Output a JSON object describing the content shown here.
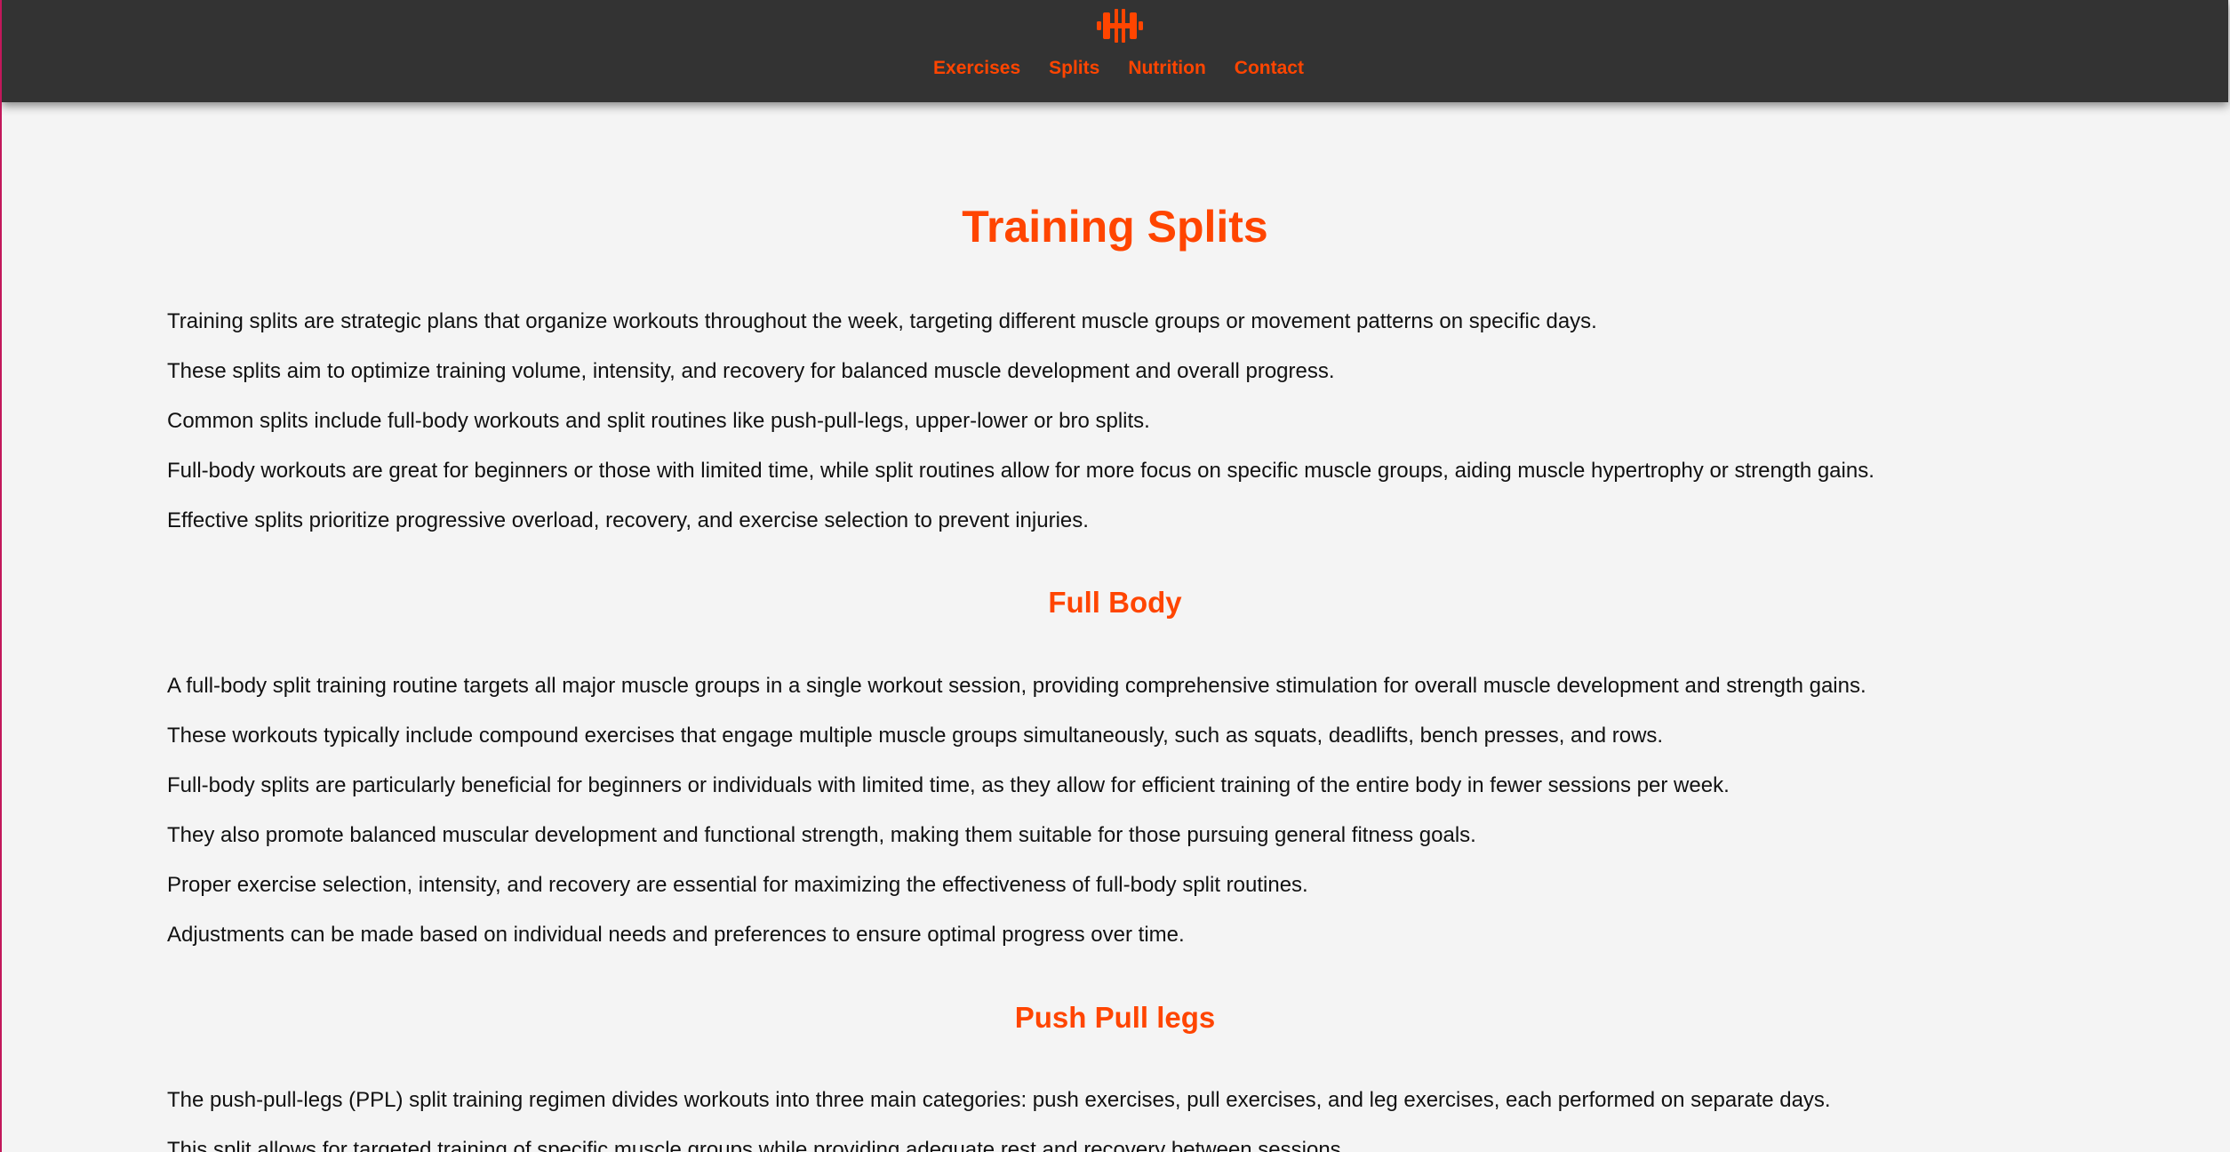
{
  "header": {
    "logo_icon": "dumbbell-icon",
    "accent_color": "#ff4500",
    "nav": [
      {
        "label": "Exercises"
      },
      {
        "label": "Splits"
      },
      {
        "label": "Nutrition"
      },
      {
        "label": "Contact"
      }
    ]
  },
  "main": {
    "title": "Training Splits",
    "intro": [
      "Training splits are strategic plans that organize workouts throughout the week, targeting different muscle groups or movement patterns on specific days.",
      "These splits aim to optimize training volume, intensity, and recovery for balanced muscle development and overall progress.",
      "Common splits include full-body workouts and split routines like push-pull-legs, upper-lower or bro splits.",
      "Full-body workouts are great for beginners or those with limited time, while split routines allow for more focus on specific muscle groups, aiding muscle hypertrophy or strength gains.",
      "Effective splits prioritize progressive overload, recovery, and exercise selection to prevent injuries."
    ],
    "sections": [
      {
        "title": "Full Body",
        "paragraphs": [
          "A full-body split training routine targets all major muscle groups in a single workout session, providing comprehensive stimulation for overall muscle development and strength gains.",
          "These workouts typically include compound exercises that engage multiple muscle groups simultaneously, such as squats, deadlifts, bench presses, and rows.",
          "Full-body splits are particularly beneficial for beginners or individuals with limited time, as they allow for efficient training of the entire body in fewer sessions per week.",
          "They also promote balanced muscular development and functional strength, making them suitable for those pursuing general fitness goals.",
          "Proper exercise selection, intensity, and recovery are essential for maximizing the effectiveness of full-body split routines.",
          "Adjustments can be made based on individual needs and preferences to ensure optimal progress over time."
        ]
      },
      {
        "title": "Push Pull legs",
        "paragraphs": [
          "The push-pull-legs (PPL) split training regimen divides workouts into three main categories: push exercises, pull exercises, and leg exercises, each performed on separate days.",
          "This split allows for targeted training of specific muscle groups while providing adequate rest and recovery between sessions."
        ]
      }
    ]
  }
}
